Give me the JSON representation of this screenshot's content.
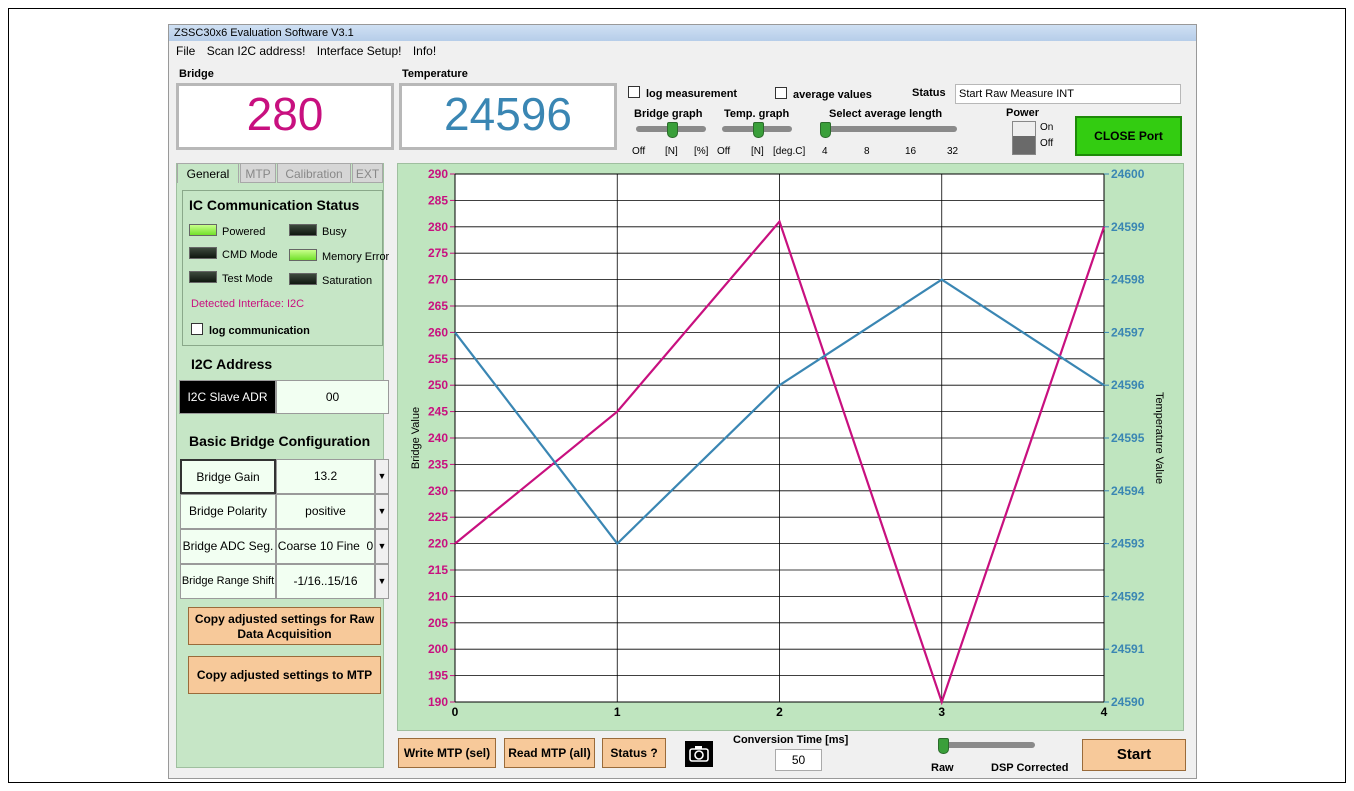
{
  "window": {
    "title": "ZSSC30x6 Evaluation Software V3.1"
  },
  "menu": [
    "File",
    "Scan I2C address!",
    "Interface Setup!",
    "Info!"
  ],
  "readouts": {
    "bridge_label": "Bridge",
    "bridge_value": "280",
    "temperature_label": "Temperature",
    "temperature_value": "24596"
  },
  "options": {
    "log_measurement": "log measurement",
    "average_values": "average values",
    "status_label": "Status",
    "status_value": "Start Raw Measure INT"
  },
  "sliders": {
    "bridge_graph": {
      "label": "Bridge graph",
      "ticks": [
        "Off",
        "[N]",
        "[%]"
      ],
      "selected": "[N]"
    },
    "temp_graph": {
      "label": "Temp. graph",
      "ticks": [
        "Off",
        "[N]",
        "[deg.C]"
      ],
      "selected": "[N]"
    },
    "average_length": {
      "label": "Select average length",
      "ticks": [
        "4",
        "8",
        "16",
        "32"
      ],
      "selected": "4"
    },
    "mode": {
      "ticks": [
        "Raw",
        "DSP Corrected"
      ],
      "selected": "Raw"
    }
  },
  "power": {
    "label": "Power",
    "on": "On",
    "off": "Off",
    "state": "Off"
  },
  "close_port": "CLOSE Port",
  "tabs": [
    "General",
    "MTP",
    "Calibration",
    "EXT"
  ],
  "ic_status": {
    "heading": "IC Communication Status",
    "leds": [
      {
        "label": "Powered",
        "on": true
      },
      {
        "label": "Busy",
        "on": false
      },
      {
        "label": "CMD Mode",
        "on": false
      },
      {
        "label": "Memory Error",
        "on": true
      },
      {
        "label": "Test Mode",
        "on": false
      },
      {
        "label": "Saturation",
        "on": false
      }
    ],
    "detected": "Detected Interface: I2C",
    "log_comm": "log communication"
  },
  "i2c": {
    "heading": "I2C Address",
    "label": "I2C Slave ADR",
    "value": "00"
  },
  "bridge_config": {
    "heading": "Basic Bridge Configuration",
    "rows": [
      {
        "label": "Bridge Gain",
        "value": "13.2"
      },
      {
        "label": "Bridge Polarity",
        "value": "positive"
      },
      {
        "label": "Bridge ADC Seg.",
        "value": "Coarse 10 Fine  0"
      },
      {
        "label": "Bridge Range Shift",
        "value": "-1/16..15/16"
      }
    ]
  },
  "buttons": {
    "copy_raw": "Copy adjusted settings for Raw Data Acquisition",
    "copy_mtp": "Copy adjusted settings to MTP",
    "write_mtp": "Write MTP (sel)",
    "read_mtp": "Read MTP (all)",
    "status": "Status ?",
    "start": "Start"
  },
  "conversion": {
    "label": "Conversion Time [ms]",
    "value": "50"
  },
  "colors": {
    "bridge": "#c8107f",
    "temperature": "#3a86b3",
    "plot_bg": "#bfe5bf",
    "close_port": "#33cc11",
    "orange_button": "#f7c99a"
  },
  "chart_data": {
    "type": "line",
    "ylabel": "Bridge Value",
    "y2label": "Temperature Value",
    "x": [
      0,
      1,
      2,
      3,
      4
    ],
    "ylim": [
      190,
      290
    ],
    "y2lim": [
      24590,
      24600
    ],
    "yticks": [
      190,
      195,
      200,
      205,
      210,
      215,
      220,
      225,
      230,
      235,
      240,
      245,
      250,
      255,
      260,
      265,
      270,
      275,
      280,
      285,
      290
    ],
    "y2ticks": [
      24590,
      24591,
      24592,
      24593,
      24594,
      24595,
      24596,
      24597,
      24598,
      24599,
      24600
    ],
    "xticks": [
      0,
      1,
      2,
      3,
      4
    ],
    "grid": true,
    "series": [
      {
        "axis": "left",
        "color": "#c8107f",
        "values": [
          220,
          245,
          281,
          190,
          280
        ]
      },
      {
        "axis": "right",
        "color": "#3a86b3",
        "values": [
          24597,
          24593,
          24596,
          24598,
          24596
        ]
      }
    ]
  }
}
